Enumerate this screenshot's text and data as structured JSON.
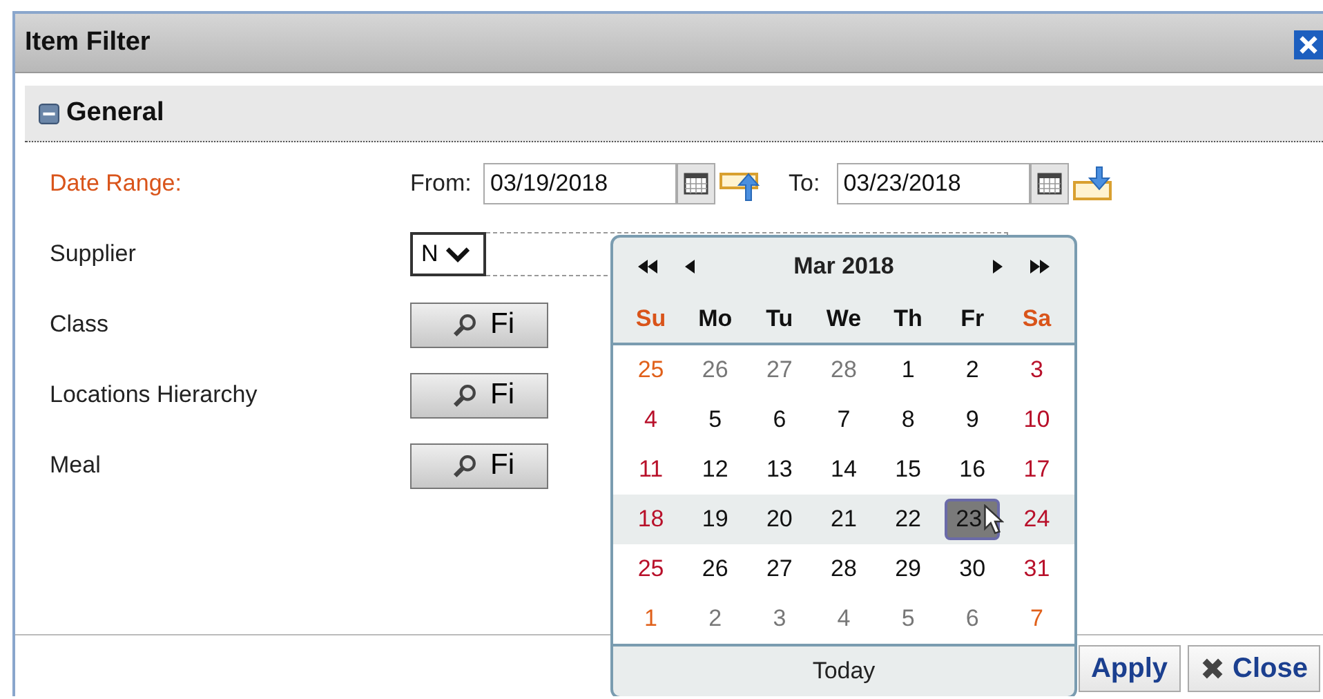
{
  "window": {
    "title": "Item Filter"
  },
  "section": {
    "title": "General",
    "expanded": true
  },
  "date_range": {
    "label": "Date Range:",
    "from_label": "From:",
    "from_value": "03/19/2018",
    "to_label": "To:",
    "to_value": "03/23/2018"
  },
  "supplier": {
    "label": "Supplier",
    "select_value": "N"
  },
  "find_rows": [
    {
      "label": "Class",
      "button": "Fi"
    },
    {
      "label": "Locations Hierarchy",
      "button": "Fi"
    },
    {
      "label": "Meal",
      "button": "Fi"
    }
  ],
  "calendar": {
    "month": "Mar 2018",
    "weekdays": [
      {
        "label": "Su",
        "kind": "weekend"
      },
      {
        "label": "Mo",
        "kind": "weekday"
      },
      {
        "label": "Tu",
        "kind": "weekday"
      },
      {
        "label": "We",
        "kind": "weekday"
      },
      {
        "label": "Th",
        "kind": "weekday"
      },
      {
        "label": "Fr",
        "kind": "weekday"
      },
      {
        "label": "Sa",
        "kind": "weekend"
      }
    ],
    "weeks": [
      {
        "highlighted": false,
        "days": [
          {
            "label": "25",
            "kind": "other-weekend",
            "selected": false
          },
          {
            "label": "26",
            "kind": "other",
            "selected": false
          },
          {
            "label": "27",
            "kind": "other",
            "selected": false
          },
          {
            "label": "28",
            "kind": "other",
            "selected": false
          },
          {
            "label": "1",
            "kind": "weekday",
            "selected": false
          },
          {
            "label": "2",
            "kind": "weekday",
            "selected": false
          },
          {
            "label": "3",
            "kind": "weekend",
            "selected": false
          }
        ]
      },
      {
        "highlighted": false,
        "days": [
          {
            "label": "4",
            "kind": "weekend",
            "selected": false
          },
          {
            "label": "5",
            "kind": "weekday",
            "selected": false
          },
          {
            "label": "6",
            "kind": "weekday",
            "selected": false
          },
          {
            "label": "7",
            "kind": "weekday",
            "selected": false
          },
          {
            "label": "8",
            "kind": "weekday",
            "selected": false
          },
          {
            "label": "9",
            "kind": "weekday",
            "selected": false
          },
          {
            "label": "10",
            "kind": "weekend",
            "selected": false
          }
        ]
      },
      {
        "highlighted": false,
        "days": [
          {
            "label": "11",
            "kind": "weekend",
            "selected": false
          },
          {
            "label": "12",
            "kind": "weekday",
            "selected": false
          },
          {
            "label": "13",
            "kind": "weekday",
            "selected": false
          },
          {
            "label": "14",
            "kind": "weekday",
            "selected": false
          },
          {
            "label": "15",
            "kind": "weekday",
            "selected": false
          },
          {
            "label": "16",
            "kind": "weekday",
            "selected": false
          },
          {
            "label": "17",
            "kind": "weekend",
            "selected": false
          }
        ]
      },
      {
        "highlighted": true,
        "days": [
          {
            "label": "18",
            "kind": "weekend",
            "selected": false
          },
          {
            "label": "19",
            "kind": "weekday",
            "selected": false
          },
          {
            "label": "20",
            "kind": "weekday",
            "selected": false
          },
          {
            "label": "21",
            "kind": "weekday",
            "selected": false
          },
          {
            "label": "22",
            "kind": "weekday",
            "selected": false
          },
          {
            "label": "23",
            "kind": "weekday",
            "selected": true
          },
          {
            "label": "24",
            "kind": "weekend",
            "selected": false
          }
        ]
      },
      {
        "highlighted": false,
        "days": [
          {
            "label": "25",
            "kind": "weekend",
            "selected": false
          },
          {
            "label": "26",
            "kind": "weekday",
            "selected": false
          },
          {
            "label": "27",
            "kind": "weekday",
            "selected": false
          },
          {
            "label": "28",
            "kind": "weekday",
            "selected": false
          },
          {
            "label": "29",
            "kind": "weekday",
            "selected": false
          },
          {
            "label": "30",
            "kind": "weekday",
            "selected": false
          },
          {
            "label": "31",
            "kind": "weekend",
            "selected": false
          }
        ]
      },
      {
        "highlighted": false,
        "days": [
          {
            "label": "1",
            "kind": "other-weekend",
            "selected": false
          },
          {
            "label": "2",
            "kind": "other",
            "selected": false
          },
          {
            "label": "3",
            "kind": "other",
            "selected": false
          },
          {
            "label": "4",
            "kind": "other",
            "selected": false
          },
          {
            "label": "5",
            "kind": "other",
            "selected": false
          },
          {
            "label": "6",
            "kind": "other",
            "selected": false
          },
          {
            "label": "7",
            "kind": "other-weekend",
            "selected": false
          }
        ]
      }
    ],
    "today_button": "Today"
  },
  "buttons": [
    {
      "label": "Apply",
      "kind": "apply"
    },
    {
      "label": "Close",
      "kind": "close"
    }
  ]
}
